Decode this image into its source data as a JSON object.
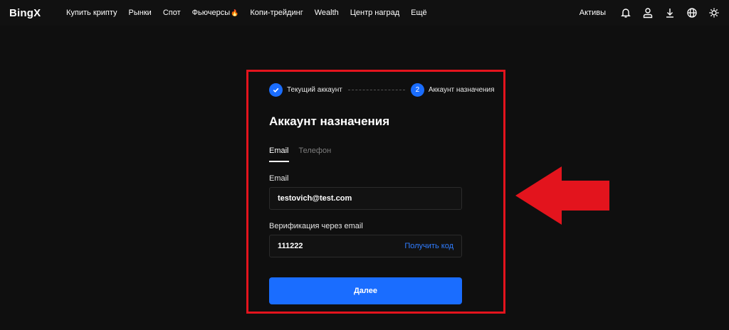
{
  "brand": {
    "logo_text": "BingX"
  },
  "nav": {
    "items": [
      {
        "label": "Купить крипту"
      },
      {
        "label": "Рынки"
      },
      {
        "label": "Спот"
      },
      {
        "label": "Фьючерсы"
      },
      {
        "label": "Копи-трейдинг"
      },
      {
        "label": "Wealth"
      },
      {
        "label": "Центр наград"
      },
      {
        "label": "Ещё"
      }
    ],
    "futures_badge_icon": "fire-icon",
    "assets_label": "Активы",
    "right_icons": [
      "bell-icon",
      "user-icon",
      "download-icon",
      "globe-icon",
      "sun-icon"
    ]
  },
  "stepper": {
    "step1_label": "Текущий аккаунт",
    "step2_number": "2",
    "step2_label": "Аккаунт назначения"
  },
  "form": {
    "title": "Аккаунт назначения",
    "tabs": [
      {
        "label": "Email",
        "active": true
      },
      {
        "label": "Телефон",
        "active": false
      }
    ],
    "email_label": "Email",
    "email_value": "testovich@test.com",
    "verification_label": "Верификация через email",
    "verification_value": "111222",
    "get_code_label": "Получить код",
    "next_label": "Далее"
  },
  "colors": {
    "accent": "#1a6dff",
    "link": "#2f7cff",
    "highlight": "#e3141d",
    "background": "#0f0f0f"
  }
}
